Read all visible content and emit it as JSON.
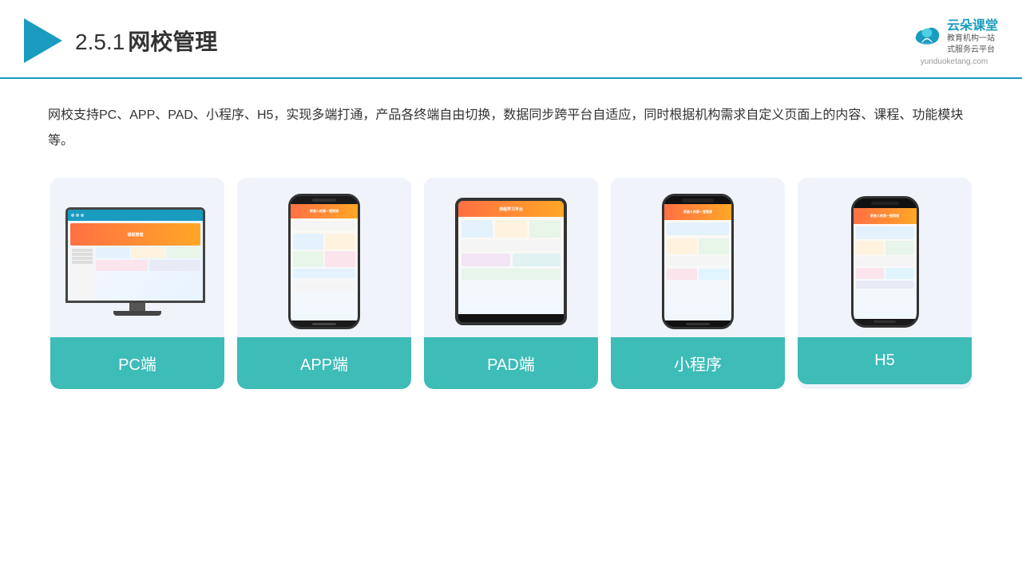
{
  "header": {
    "section_number": "2.5.1",
    "title": "网校管理",
    "brand": {
      "name": "云朵课堂",
      "url": "yunduoketang.com",
      "tagline_line1": "教育机构一站",
      "tagline_line2": "式服务云平台"
    }
  },
  "description": "网校支持PC、APP、PAD、小程序、H5，实现多端打通，产品各终端自由切换，数据同步跨平台自适应，同时根据机构需求自定义页面上的内容、课程、功能模块等。",
  "cards": [
    {
      "id": "pc",
      "label": "PC端"
    },
    {
      "id": "app",
      "label": "APP端"
    },
    {
      "id": "pad",
      "label": "PAD端"
    },
    {
      "id": "mini-program",
      "label": "小程序"
    },
    {
      "id": "h5",
      "label": "H5"
    }
  ],
  "colors": {
    "accent": "#1a9bc0",
    "card_bg": "#f0f4fa",
    "card_label_bg": "#3dbcb8"
  }
}
